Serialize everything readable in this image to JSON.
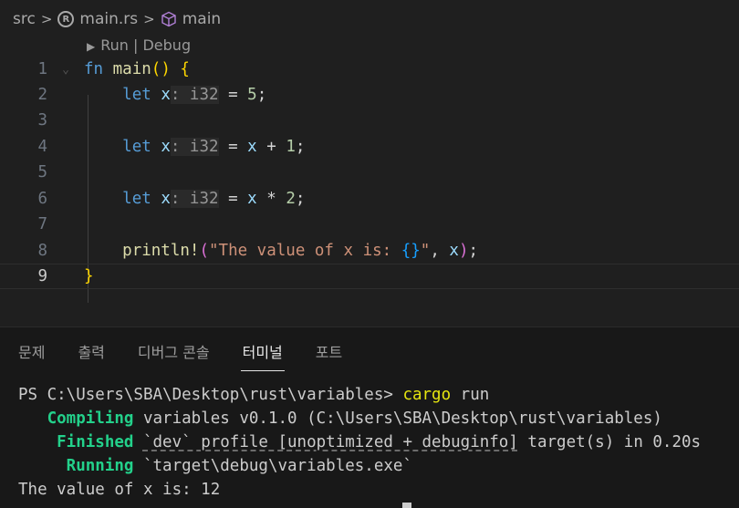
{
  "breadcrumb": {
    "folder": "src",
    "file": "main.rs",
    "symbol": "main"
  },
  "editor": {
    "codelens": "Run | Debug",
    "line_numbers": [
      "1",
      "2",
      "3",
      "4",
      "5",
      "6",
      "7",
      "8",
      "9"
    ],
    "lines": {
      "l1": {
        "kw": "fn",
        "name": "main",
        "open": "()",
        "brace": "{"
      },
      "l2": {
        "kw": "let",
        "var": "x",
        "hint": ": i32",
        "op": " = ",
        "val": "5",
        "end": ";"
      },
      "l4": {
        "kw": "let",
        "var": "x",
        "hint": ": i32",
        "op": " = ",
        "var2": "x",
        "op2": " + ",
        "val": "1",
        "end": ";"
      },
      "l6": {
        "kw": "let",
        "var": "x",
        "hint": ": i32",
        "op": " = ",
        "var2": "x",
        "op2": " * ",
        "val": "2",
        "end": ";"
      },
      "l8": {
        "macro": "println!",
        "open": "(",
        "str1": "\"The value of x is: ",
        "ph": "{}",
        "str2": "\"",
        ", ": ", ",
        "var": "x",
        "close": ")",
        "end": ";"
      },
      "l9": {
        "brace": "}"
      }
    }
  },
  "panel": {
    "tabs": [
      "문제",
      "출력",
      "디버그 콘솔",
      "터미널",
      "포트"
    ],
    "active_tab": "터미널",
    "terminal": {
      "prompt": "PS C:\\Users\\SBA\\Desktop\\rust\\variables> ",
      "cmd": "cargo",
      "arg": " run",
      "compiling_label": "   Compiling",
      "compiling_text": " variables v0.1.0 (C:\\Users\\SBA\\Desktop\\rust\\variables)",
      "finished_label": "    Finished",
      "finished_profile": "`dev` profile [unoptimized + debuginfo]",
      "finished_text": " target(s) in 0.20s",
      "running_label": "     Running",
      "running_text": " `target\\debug\\variables.exe`",
      "output": "The value of x is: 12"
    }
  }
}
